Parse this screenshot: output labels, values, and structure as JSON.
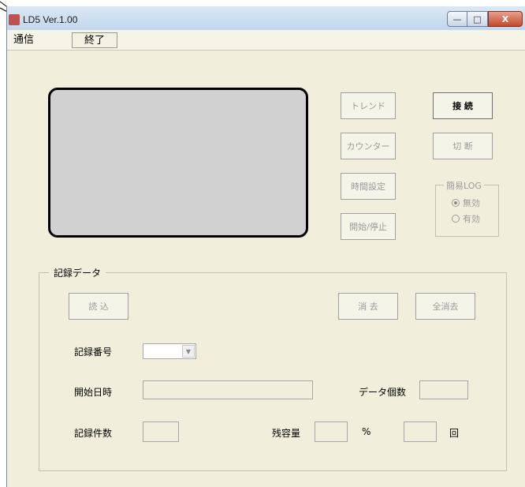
{
  "window": {
    "title": "LD5  Ver.1.00",
    "minimize_label": "—",
    "maximize_label": "□",
    "close_label": "X"
  },
  "menu": {
    "comm": "通信",
    "exit": "終了"
  },
  "controls": {
    "trend": "トレンド",
    "connect": "接 続",
    "counter": "カウンター",
    "disconnect": "切 断",
    "time_setting": "時間設定",
    "start_stop": "開始/停止"
  },
  "simple_log": {
    "title": "簡易LOG",
    "disabled_label": "無効",
    "enabled_label": "有効",
    "selected": "無効"
  },
  "record_data": {
    "group_title": "記録データ",
    "read_button": "読 込",
    "delete_button": "消 去",
    "delete_all_button": "全消去",
    "record_number_label": "記録番号",
    "start_datetime_label": "開始日時",
    "data_count_label": "データ個数",
    "record_count_label": "記録件数",
    "remaining_label": "残容量",
    "percent_unit": "%",
    "times_unit": "回"
  }
}
